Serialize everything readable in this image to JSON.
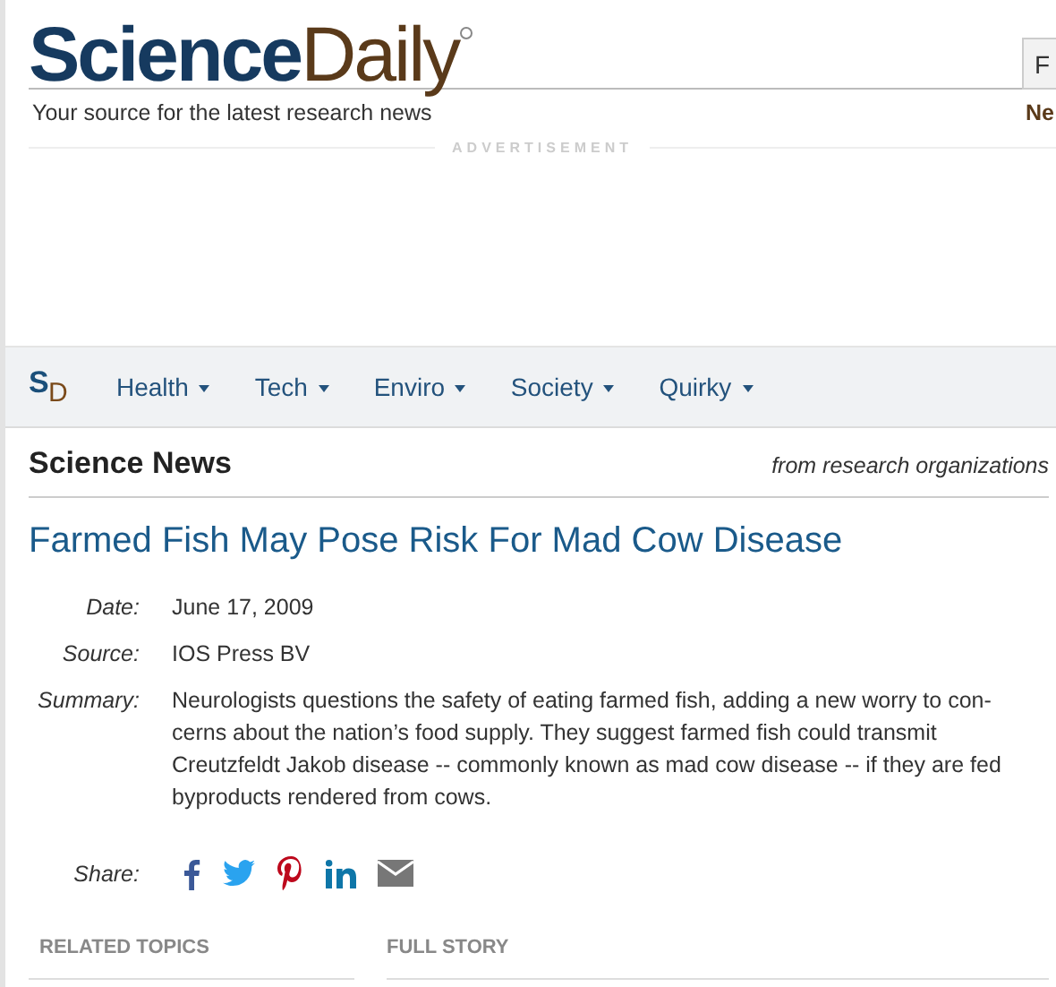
{
  "header": {
    "logo": {
      "first": "Science",
      "second": "Daily"
    },
    "tagline": "Your source for the latest research news",
    "search_button": "F",
    "right_link": "Ne",
    "ad_label": "ADVERTISEMENT"
  },
  "nav": {
    "mark": {
      "first": "S",
      "second": "D"
    },
    "items": [
      {
        "label": "Health"
      },
      {
        "label": "Tech"
      },
      {
        "label": "Enviro"
      },
      {
        "label": "Society"
      },
      {
        "label": "Quirky"
      }
    ]
  },
  "section": {
    "title": "Science News",
    "subtitle": "from research organizations"
  },
  "article": {
    "title": "Farmed Fish May Pose Risk For Mad Cow Disease",
    "meta": [
      {
        "label": "Date:",
        "value": "June 17, 2009"
      },
      {
        "label": "Source:",
        "value": "IOS Press BV"
      },
      {
        "label": "Summary:",
        "value": "Neurologists questions the safety of eating farmed fish, adding a new worry to con-cerns about the nation’s food supply. They suggest farmed fish could transmit Creutzfeldt Jakob disease -- commonly known as mad cow disease -- if they are fed byproducts rendered from cows."
      }
    ],
    "share_label": "Share:",
    "share": [
      {
        "kind": "facebook"
      },
      {
        "kind": "twitter"
      },
      {
        "kind": "pinterest"
      },
      {
        "kind": "linkedin"
      },
      {
        "kind": "email"
      }
    ]
  },
  "bottom": {
    "left_heading": "RELATED TOPICS",
    "right_heading": "FULL STORY"
  }
}
